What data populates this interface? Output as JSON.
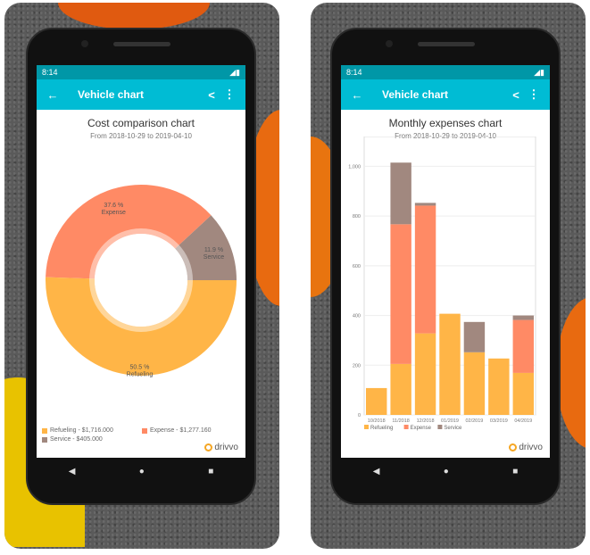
{
  "phones": [
    {
      "time": "8:14",
      "toolbar_title": "Vehicle chart",
      "chart_title": "Cost comparison chart",
      "subtitle": "From 2018-10-29 to 2019-04-10",
      "legend": [
        "Refueling - $1,716.000",
        "Expense - $1,277.160",
        "Service - $405.000"
      ],
      "brand": "drivvo"
    },
    {
      "time": "8:14",
      "toolbar_title": "Vehicle chart",
      "chart_title": "Monthly expenses chart",
      "subtitle": "From 2018-10-29 to 2019-04-10",
      "legend": [
        "Refueling",
        "Expense",
        "Service"
      ],
      "brand": "drivvo"
    }
  ],
  "icons": {
    "back": "arrow-left-icon",
    "share": "share-icon",
    "more": "more-vert-icon",
    "nav": [
      "back-triangle-icon",
      "home-circle-icon",
      "recents-square-icon"
    ]
  },
  "colors": {
    "refueling": "#ffb547",
    "expense": "#ff8a65",
    "service": "#a1887f",
    "toolbar": "#00bcd4",
    "status": "#0097a7"
  },
  "chart_data": [
    {
      "type": "pie",
      "donut": true,
      "title": "Cost comparison chart",
      "subtitle": "From 2018-10-29 to 2019-04-10",
      "slices": [
        {
          "name": "Refueling",
          "percent": 50.5,
          "label": "50.5 %",
          "value": 1716.0
        },
        {
          "name": "Expense",
          "percent": 37.6,
          "label": "37.6 %",
          "value": 1277.16
        },
        {
          "name": "Service",
          "percent": 11.9,
          "label": "11.9 %",
          "value": 405.0
        }
      ],
      "legend_placement": "bottom"
    },
    {
      "type": "bar",
      "stacked": true,
      "title": "Monthly expenses chart",
      "subtitle": "From 2018-10-29 to 2019-04-10",
      "categories": [
        "10/2018",
        "11/2018",
        "12/2018",
        "01/2019",
        "02/2019",
        "03/2019",
        "04/2019"
      ],
      "series": [
        {
          "name": "Refueling",
          "values": [
            108,
            205,
            328,
            407,
            252,
            227,
            169
          ]
        },
        {
          "name": "Expense",
          "values": [
            0,
            562,
            514,
            0,
            0,
            0,
            213
          ]
        },
        {
          "name": "Service",
          "values": [
            0,
            248,
            11,
            0,
            122,
            0,
            18
          ]
        }
      ],
      "yticks": [
        "0",
        "200",
        "400",
        "600",
        "800",
        "1,000"
      ],
      "ylim": [
        0,
        1120
      ],
      "grid": true,
      "legend_placement": "bottom"
    }
  ]
}
